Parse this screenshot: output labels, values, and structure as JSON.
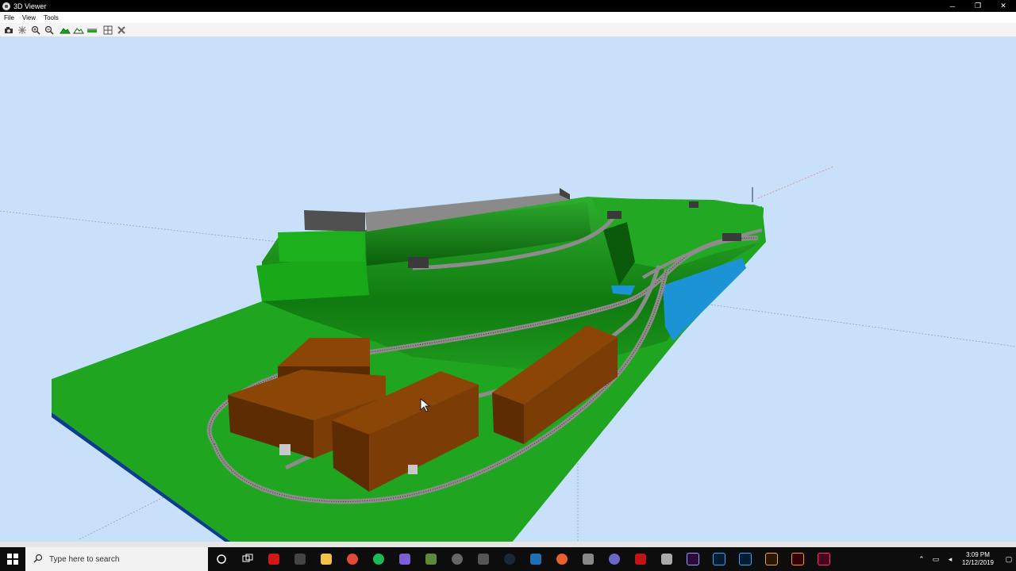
{
  "window": {
    "title": "3D Viewer",
    "minimize": "─",
    "restore": "❐",
    "close": "✕"
  },
  "menu": [
    "File",
    "View",
    "Tools"
  ],
  "toolbar": [
    "camera-icon",
    "fit-view-icon",
    "zoom-in-icon",
    "zoom-out-icon",
    "terrain-icon",
    "terrain-wire-icon",
    "track-icon",
    "grid-icon",
    "close-scene-icon"
  ],
  "colors": {
    "sky": "#c9e0fb",
    "grass": "#1fa51f",
    "grass_dark": "#0a6a0a",
    "building": "#7b3c05",
    "water": "#1b93d4",
    "wall": "#7a7a7a"
  },
  "taskbar": {
    "search_placeholder": "Type here to search",
    "time": "3:09 PM",
    "date": "12/12/2019"
  }
}
